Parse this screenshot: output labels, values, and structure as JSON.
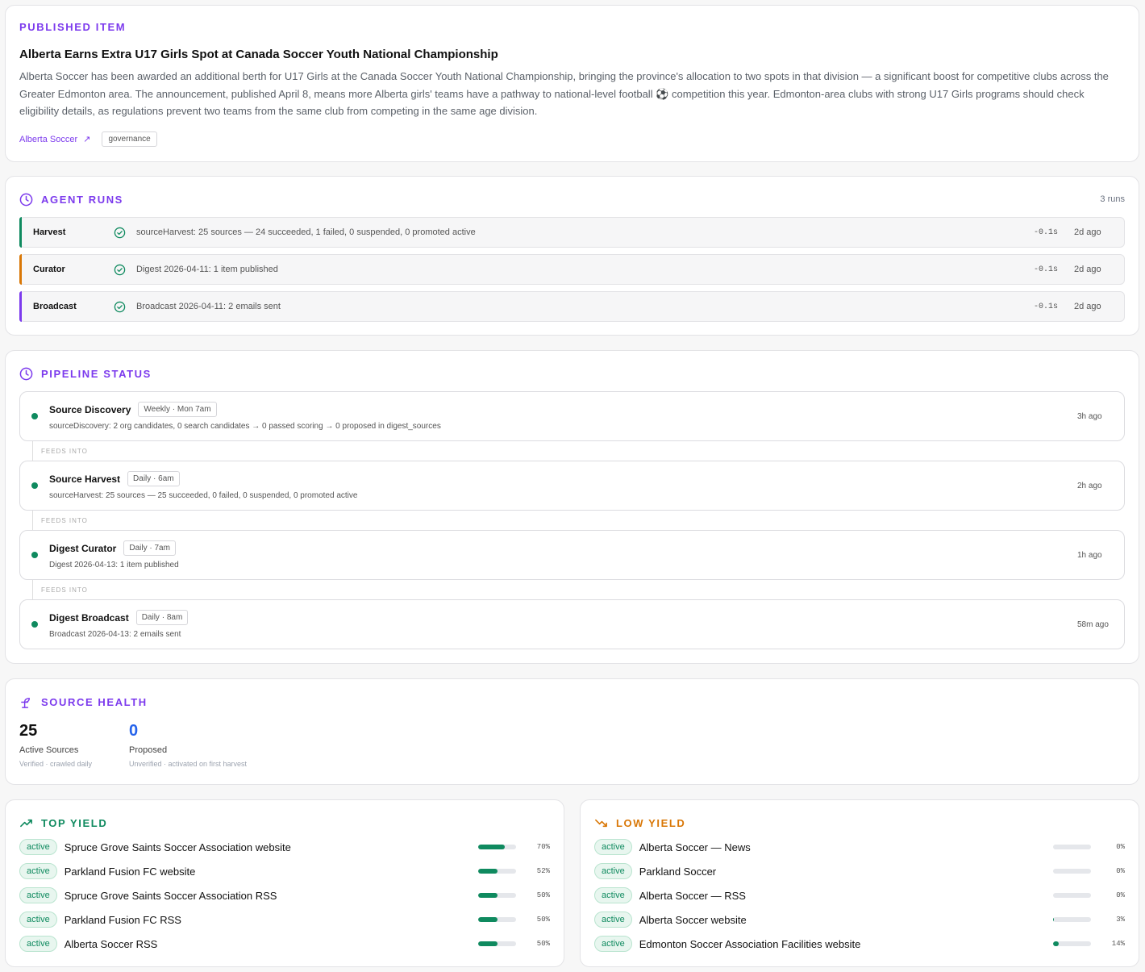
{
  "published": {
    "eyebrow": "PUBLISHED ITEM",
    "title": "Alberta Earns Extra U17 Girls Spot at Canada Soccer Youth National Championship",
    "body": "Alberta Soccer has been awarded an additional berth for U17 Girls at the Canada Soccer Youth National Championship, bringing the province's allocation to two spots in that division — a significant boost for competitive clubs across the Greater Edmonton area. The announcement, published April 8, means more Alberta girls' teams have a pathway to national-level football ⚽ competition this year. Edmonton-area clubs with strong U17 Girls programs should check eligibility details, as regulations prevent two teams from the same club from competing in the same age division.",
    "source_label": "Alberta Soccer",
    "source_arrow": "↗",
    "tag": "governance"
  },
  "runs": {
    "title": "AGENT RUNS",
    "count": "3 runs",
    "items": [
      {
        "name": "Harvest",
        "summary": "sourceHarvest: 25 sources — 24 succeeded, 1 failed, 0 suspended, 0 promoted active",
        "duration": "-0.1s",
        "ago": "2d ago",
        "color": "#0f8a5f"
      },
      {
        "name": "Curator",
        "summary": "Digest 2026-04-11: 1 item published",
        "duration": "-0.1s",
        "ago": "2d ago",
        "color": "#d97706"
      },
      {
        "name": "Broadcast",
        "summary": "Broadcast 2026-04-11: 2 emails sent",
        "duration": "-0.1s",
        "ago": "2d ago",
        "color": "#7c3aed"
      }
    ]
  },
  "pipeline": {
    "title": "PIPELINE STATUS",
    "feeds_label": "FEEDS INTO",
    "stages": [
      {
        "name": "Source Discovery",
        "schedule": "Weekly · Mon 7am",
        "detail": "sourceDiscovery: 2 org candidates, 0 search candidates → 0 passed scoring → 0 proposed in digest_sources",
        "ago": "3h ago"
      },
      {
        "name": "Source Harvest",
        "schedule": "Daily · 6am",
        "detail": "sourceHarvest: 25 sources — 25 succeeded, 0 failed, 0 suspended, 0 promoted active",
        "ago": "2h ago"
      },
      {
        "name": "Digest Curator",
        "schedule": "Daily · 7am",
        "detail": "Digest 2026-04-13: 1 item published",
        "ago": "1h ago"
      },
      {
        "name": "Digest Broadcast",
        "schedule": "Daily · 8am",
        "detail": "Broadcast 2026-04-13: 2 emails sent",
        "ago": "58m ago"
      }
    ]
  },
  "health": {
    "title": "SOURCE HEALTH",
    "stats": [
      {
        "value": "25",
        "label": "Active Sources",
        "sub": "Verified · crawled daily",
        "color": "#111111"
      },
      {
        "value": "0",
        "label": "Proposed",
        "sub": "Unverified · activated on first harvest",
        "color": "#2563eb"
      }
    ]
  },
  "top_yield": {
    "title": "TOP YIELD",
    "color": "#0f8a5f",
    "items": [
      {
        "status": "active",
        "name": "Spruce Grove Saints Soccer Association website",
        "pct": "70%",
        "fill": 0.7
      },
      {
        "status": "active",
        "name": "Parkland Fusion FC website",
        "pct": "52%",
        "fill": 0.52
      },
      {
        "status": "active",
        "name": "Spruce Grove Saints Soccer Association RSS",
        "pct": "50%",
        "fill": 0.5
      },
      {
        "status": "active",
        "name": "Parkland Fusion FC RSS",
        "pct": "50%",
        "fill": 0.5
      },
      {
        "status": "active",
        "name": "Alberta Soccer RSS",
        "pct": "50%",
        "fill": 0.5
      }
    ]
  },
  "low_yield": {
    "title": "LOW YIELD",
    "color": "#d97706",
    "items": [
      {
        "status": "active",
        "name": "Alberta Soccer — News",
        "pct": "0%",
        "fill": 0
      },
      {
        "status": "active",
        "name": "Parkland Soccer",
        "pct": "0%",
        "fill": 0
      },
      {
        "status": "active",
        "name": "Alberta Soccer — RSS",
        "pct": "0%",
        "fill": 0
      },
      {
        "status": "active",
        "name": "Alberta Soccer website",
        "pct": "3%",
        "fill": 0.03
      },
      {
        "status": "active",
        "name": "Edmonton Soccer Association Facilities website",
        "pct": "14%",
        "fill": 0.14
      }
    ]
  }
}
